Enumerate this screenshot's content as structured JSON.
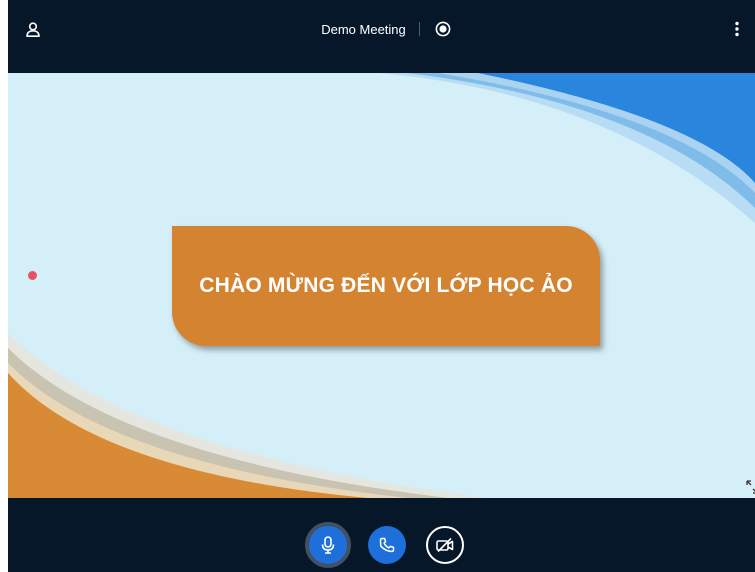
{
  "topbar": {
    "meeting_title": "Demo Meeting",
    "icons": {
      "user": "user-icon",
      "record": "record-icon",
      "more": "more-vertical-icon"
    }
  },
  "slide": {
    "title": "CHÀO MỪNG ĐẾN VỚI LỚP HỌC ẢO"
  },
  "controls": {
    "icons": {
      "mic": "microphone-icon",
      "phone": "phone-icon",
      "camera": "camera-off-icon",
      "fullscreen": "fullscreen-icon"
    }
  },
  "colors": {
    "bar_background": "#06172a",
    "slide_background": "#d5eff9",
    "slide_title_box": "#d48431",
    "accent_blue": "#1e6fd9",
    "pointer": "#e8525f"
  }
}
